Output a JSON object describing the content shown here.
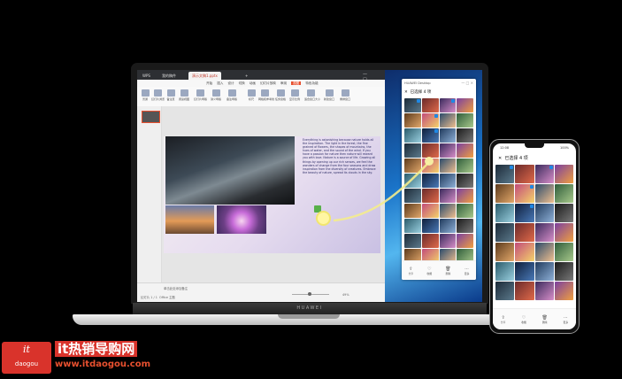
{
  "laptop": {
    "brand": "HUAWEI",
    "wps": {
      "tabs": [
        "WPS",
        "我的稿件",
        "演示文稿1.pptx",
        "+"
      ],
      "menu": [
        "开始",
        "插入",
        "设计",
        "切换",
        "动画",
        "幻灯片放映",
        "审阅",
        "视图",
        "特色功能"
      ],
      "menu_selected": "视图",
      "ribbon": [
        "普通",
        "幻灯片浏览",
        "备注页",
        "阅读视图",
        "幻灯片母版",
        "讲义母版",
        "备注母版",
        "标尺",
        "网格和参考线",
        "任务窗格",
        "显示比例",
        "适合窗口大小",
        "新建窗口",
        "重排窗口"
      ],
      "notes_placeholder": "单击此处添加备注",
      "status_left": "幻灯片 1 / 1",
      "status_theme": "Office 主题",
      "zoom": "49%",
      "slide_text": "Everything is astonishing because nature holds all the inspiration. The light in the forest, the fine grained of flowers, the shapes of mountains, the hues of water, and the sound of the wind. If you have a passion for nature then nature will reward you with love. Nature is a source of life. Growing all things by opening up our rich senses, we feel the wonders of change from the four seasons and draw inspiration from the diversity of creatures. Embrace the beauty of nature, spread its clouds in the sky."
    },
    "collab_window": {
      "title": "HUAWEI Desktop",
      "controls": "— □ ×",
      "header": "已选择 4 项",
      "actions": [
        "分享",
        "收藏",
        "删除",
        "更多"
      ]
    }
  },
  "phone": {
    "status_left": "12:08",
    "status_right": "100%",
    "header": "已选择 4 项",
    "actions": [
      "分享",
      "收藏",
      "删除",
      "更多"
    ]
  },
  "watermark": {
    "logo_top": "it",
    "logo_bottom": "daogou",
    "cn": "it热销导购网",
    "url": "www.itdaogou.com"
  }
}
